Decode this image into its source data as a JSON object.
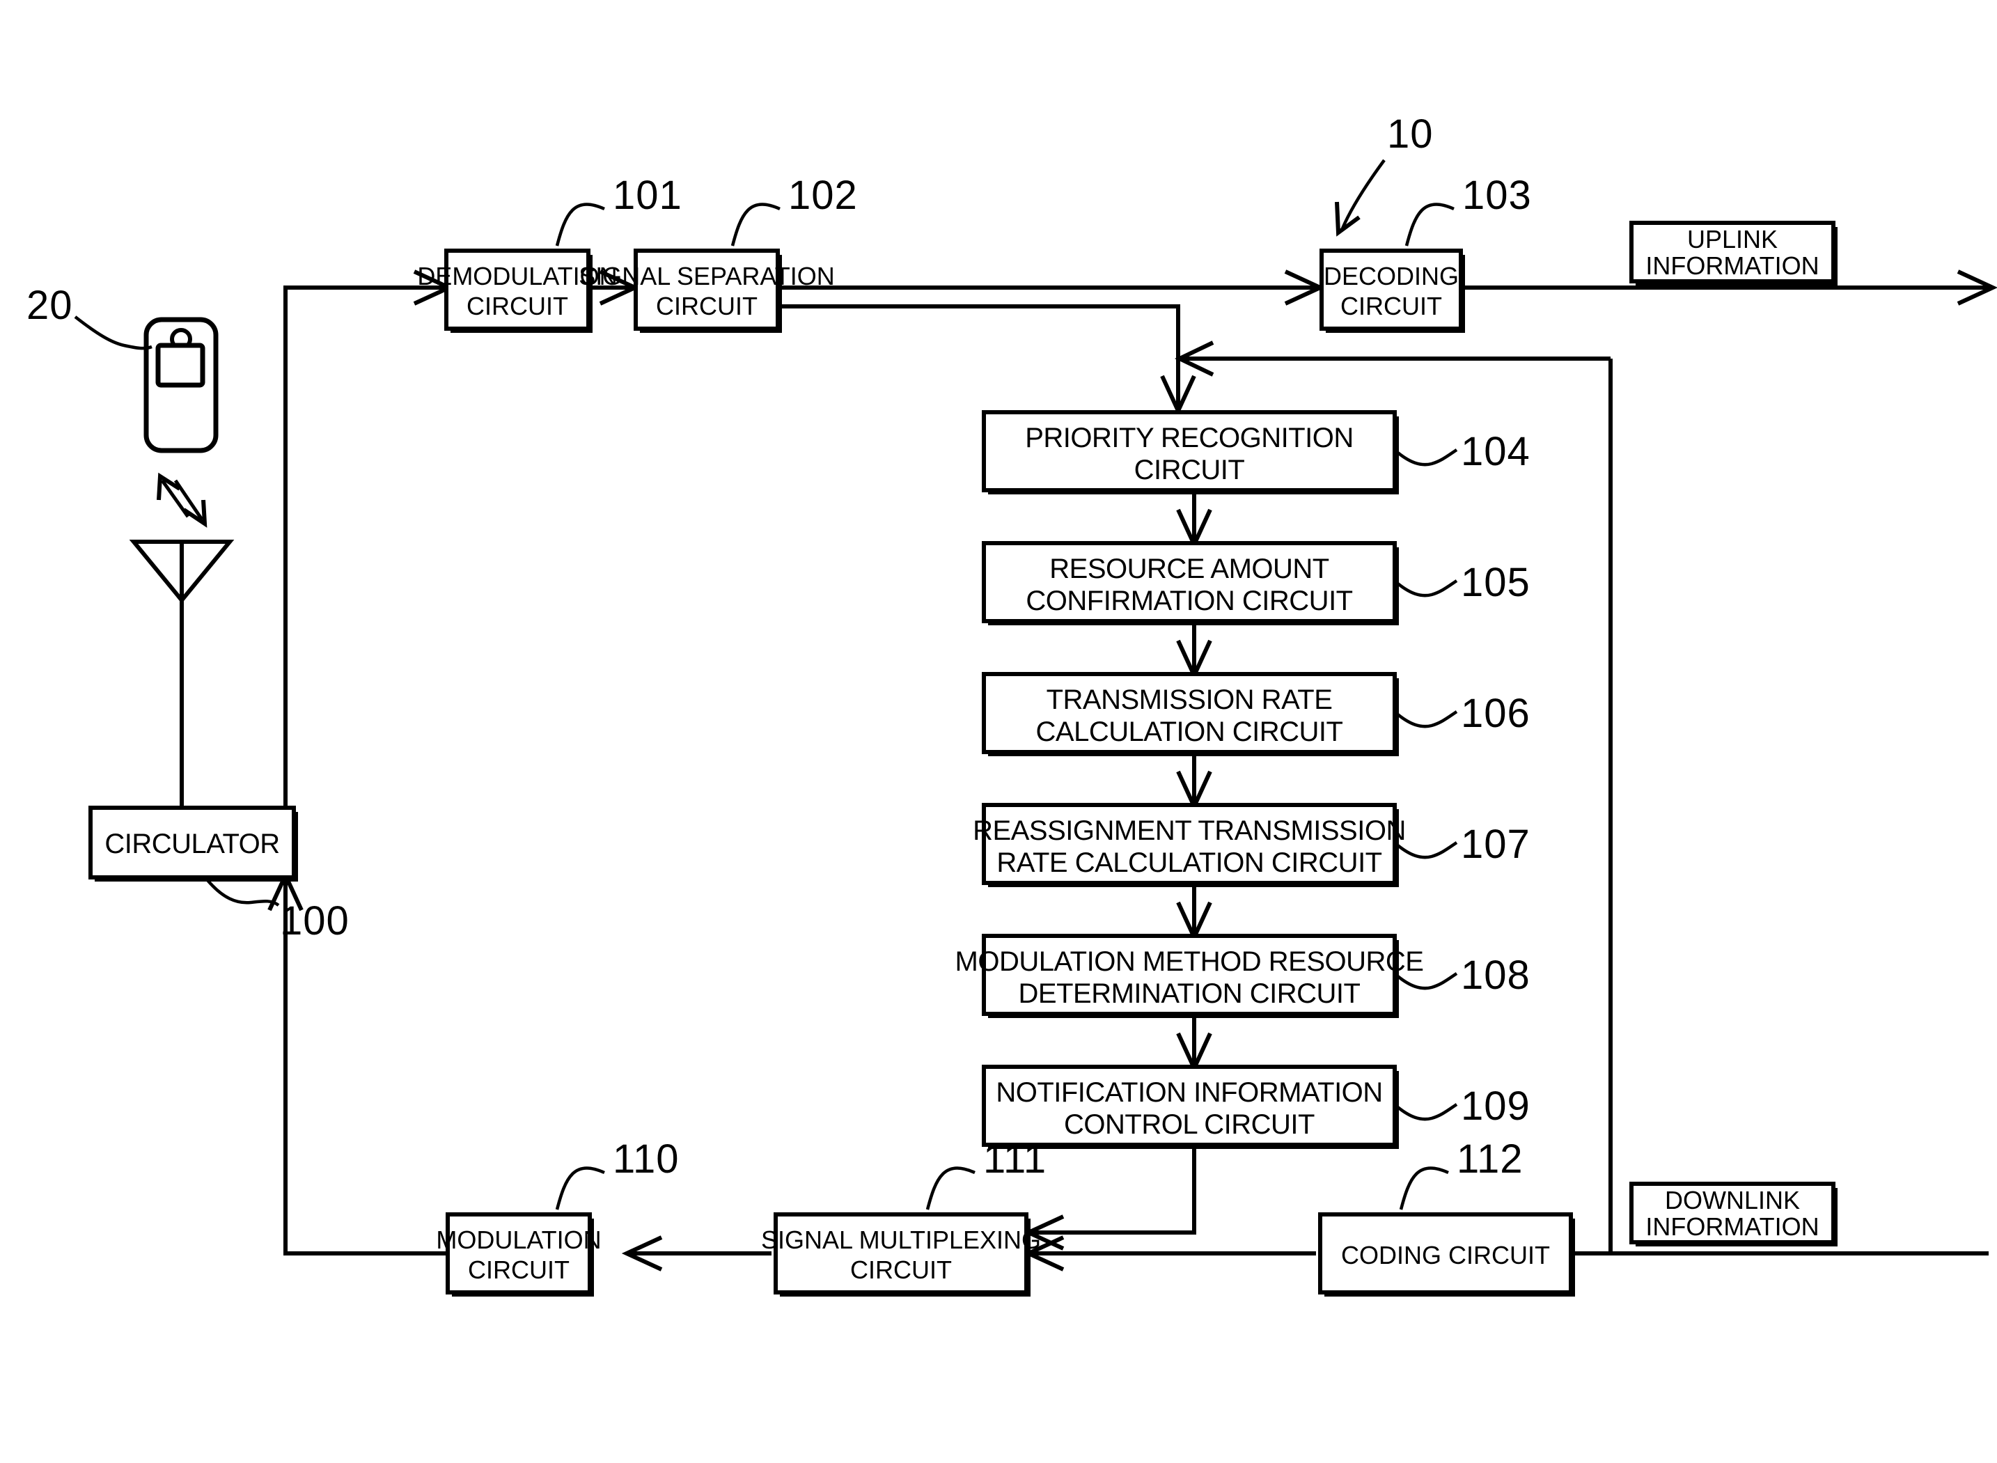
{
  "figure": {
    "type": "patent-block-diagram",
    "system_ref": "10",
    "base_station_ref": "100",
    "mobile_terminal_ref": "20"
  },
  "refs": {
    "system": "10",
    "terminal": "20",
    "base_station": "100",
    "demodulation": "101",
    "signal_separation": "102",
    "decoding": "103",
    "priority_recognition": "104",
    "resource_amount": "105",
    "transmission_rate": "106",
    "reassignment_rate": "107",
    "modulation_method": "108",
    "notification_info": "109",
    "modulation": "110",
    "signal_multiplexing": "111",
    "coding": "112"
  },
  "blocks": {
    "circulator": {
      "line1": "CIRCULATOR",
      "line2": ""
    },
    "demodulation": {
      "line1": "DEMODULATION",
      "line2": "CIRCUIT"
    },
    "signal_separation": {
      "line1": "SIGNAL SEPARATION",
      "line2": "CIRCUIT"
    },
    "decoding": {
      "line1": "DECODING",
      "line2": "CIRCUIT"
    },
    "priority_recognition": {
      "line1": "PRIORITY RECOGNITION",
      "line2": "CIRCUIT"
    },
    "resource_amount": {
      "line1": "RESOURCE AMOUNT",
      "line2": "CONFIRMATION CIRCUIT"
    },
    "transmission_rate": {
      "line1": "TRANSMISSION RATE",
      "line2": "CALCULATION CIRCUIT"
    },
    "reassignment_rate": {
      "line1": "REASSIGNMENT TRANSMISSION",
      "line2": "RATE CALCULATION CIRCUIT"
    },
    "modulation_method": {
      "line1": "MODULATION METHOD RESOURCE",
      "line2": "DETERMINATION CIRCUIT"
    },
    "notification_info": {
      "line1": "NOTIFICATION INFORMATION",
      "line2": "CONTROL CIRCUIT"
    },
    "modulation": {
      "line1": "MODULATION",
      "line2": "CIRCUIT"
    },
    "signal_multiplexing": {
      "line1": "SIGNAL MULTIPLEXING",
      "line2": "CIRCUIT"
    },
    "coding": {
      "line1": "CODING CIRCUIT",
      "line2": ""
    }
  },
  "io_labels": {
    "uplink": {
      "line1": "UPLINK",
      "line2": "INFORMATION"
    },
    "downlink": {
      "line1": "DOWNLINK",
      "line2": "INFORMATION"
    }
  },
  "icons": {
    "mobile_terminal": "mobile-phone-icon",
    "antenna": "antenna-icon",
    "radio_link": "bidirectional-radio-link-icon"
  },
  "colors": {
    "stroke": "#000000",
    "background": "#ffffff"
  }
}
